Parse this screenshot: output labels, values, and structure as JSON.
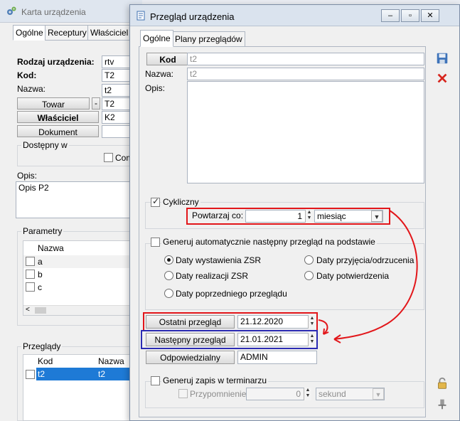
{
  "background_window": {
    "title": "Karta urządzenia",
    "tabs": [
      "Ogólne",
      "Receptury",
      "Właściciel"
    ],
    "rodzaj_label": "Rodzaj urządzenia:",
    "rodzaj_value": "rtv",
    "kod_label": "Kod:",
    "kod_value": "T2",
    "nazwa_label": "Nazwa:",
    "nazwa_value": "t2",
    "towar_button": "Towar",
    "towar_dash": "-",
    "towar_value": "T2",
    "wlasciciel_button": "Właściciel",
    "wlasciciel_value": "K2",
    "dokument_button": "Dokument",
    "dokument_value": "",
    "dostepny_label": "Dostępny w",
    "com_label": "Com",
    "opis_label": "Opis:",
    "opis_value": "Opis P2",
    "parametry_label": "Parametry",
    "parametry_header": "Nazwa",
    "parametry_rows": [
      "a",
      "b",
      "c"
    ],
    "przeglady_label": "Przeglądy",
    "przeglady_headers": [
      "Kod",
      "Nazwa"
    ],
    "przeglady_row": [
      "t2",
      "t2"
    ]
  },
  "dialog": {
    "title": "Przegląd urządzenia",
    "tabs": [
      "Ogólne",
      "Plany przeglądów"
    ],
    "kod_button": "Kod",
    "kod_value": "t2",
    "nazwa_label": "Nazwa:",
    "nazwa_value": "t2",
    "opis_label": "Opis:",
    "opis_value": "",
    "cykliczny_label": "Cykliczny",
    "powtarzaj_label": "Powtarzaj co:",
    "powtarzaj_value": "1",
    "powtarzaj_unit": "miesiąc",
    "generuj_label": "Generuj automatycznie następny przegląd na podstawie",
    "radio_options": {
      "wystawienia": "Daty wystawienia ZSR",
      "przyjecia": "Daty przyjęcia/odrzucenia",
      "realizacji": "Daty realizacji ZSR",
      "potwierdzenia": "Daty potwierdzenia",
      "poprzedniego": "Daty poprzedniego przeglądu"
    },
    "ostatni_button": "Ostatni przegląd",
    "ostatni_value": "21.12.2020",
    "nastepny_button": "Następny przegląd",
    "nastepny_value": "21.01.2021",
    "odpowiedzialny_button": "Odpowiedzialny",
    "odpowiedzialny_value": "ADMIN",
    "generuj_zapis_label": "Generuj zapis w terminarzu",
    "przypomnienie_label": "Przypomnienie",
    "przypomnienie_value": "0",
    "przypomnienie_unit": "sekund"
  },
  "colors": {
    "annotation_red": "#e2161a",
    "annotation_blue": "#2b2bb3",
    "selection": "#1e7ad6"
  }
}
